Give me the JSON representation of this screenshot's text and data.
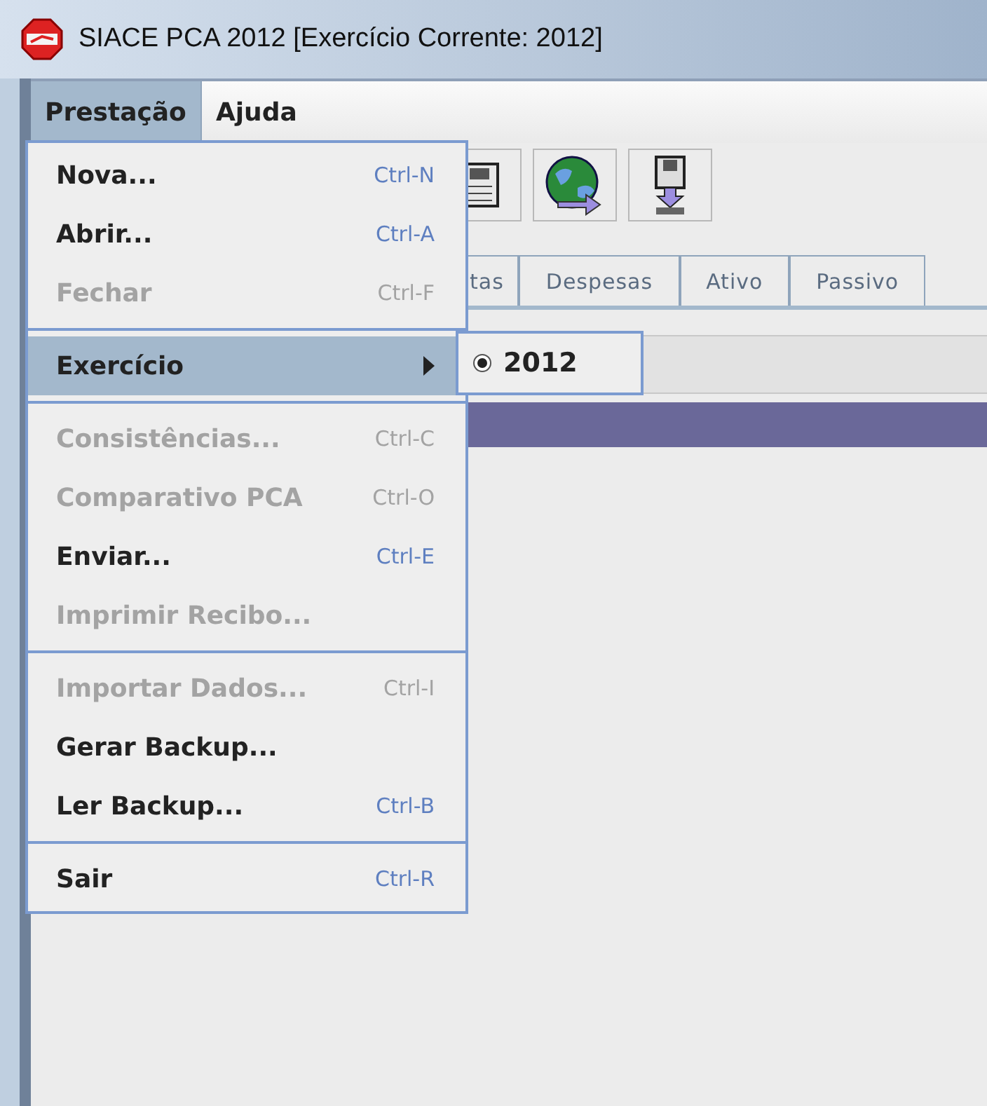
{
  "window": {
    "title": "SIACE PCA 2012 [Exercício Corrente: 2012]"
  },
  "menubar": [
    {
      "label": "Prestação",
      "selected": true
    },
    {
      "label": "Ajuda",
      "selected": false
    }
  ],
  "toolbar": {
    "tools": [
      {
        "kind": "document"
      },
      {
        "kind": "globe"
      },
      {
        "kind": "disk"
      }
    ]
  },
  "tabs": [
    {
      "label": "tas",
      "selected": false
    },
    {
      "label": "Despesas",
      "selected": false
    },
    {
      "label": "Ativo",
      "selected": false
    },
    {
      "label": "Passivo",
      "selected": false
    }
  ],
  "menu": {
    "items": [
      {
        "kind": "item",
        "label": "Nova...",
        "shortcut": "Ctrl-N",
        "disabled": false
      },
      {
        "kind": "item",
        "label": "Abrir...",
        "shortcut": "Ctrl-A",
        "disabled": false
      },
      {
        "kind": "item",
        "label": "Fechar",
        "shortcut": "Ctrl-F",
        "disabled": true
      },
      {
        "kind": "separator"
      },
      {
        "kind": "submenu",
        "label": "Exercício",
        "selected": true,
        "children": [
          {
            "label": "2012",
            "selected": true
          }
        ]
      },
      {
        "kind": "separator"
      },
      {
        "kind": "item",
        "label": "Consistências...",
        "shortcut": "Ctrl-C",
        "disabled": true
      },
      {
        "kind": "item",
        "label": "Comparativo PCA",
        "shortcut": "Ctrl-O",
        "disabled": true
      },
      {
        "kind": "item",
        "label": "Enviar...",
        "shortcut": "Ctrl-E",
        "disabled": false
      },
      {
        "kind": "item",
        "label": "Imprimir Recibo...",
        "disabled": true
      },
      {
        "kind": "separator"
      },
      {
        "kind": "item",
        "label": "Importar Dados...",
        "shortcut": "Ctrl-I",
        "disabled": true
      },
      {
        "kind": "item",
        "label": "Gerar Backup...",
        "disabled": false
      },
      {
        "kind": "item",
        "label": "Ler Backup...",
        "shortcut": "Ctrl-B",
        "disabled": false
      },
      {
        "kind": "separator"
      },
      {
        "kind": "item",
        "label": "Sair",
        "shortcut": "Ctrl-R",
        "disabled": false
      }
    ]
  }
}
